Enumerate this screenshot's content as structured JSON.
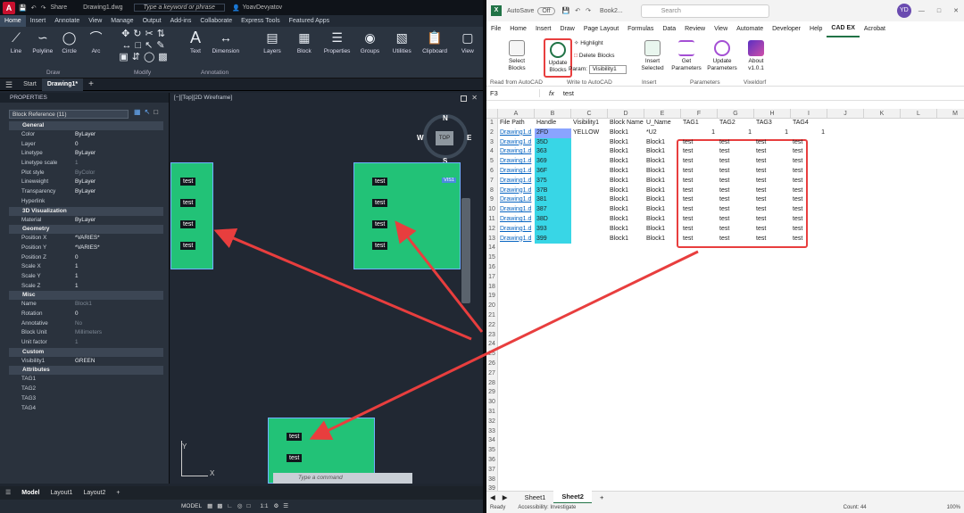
{
  "autocad": {
    "title_file": "Drawing1.dwg",
    "share_label": "Share",
    "search_placeholder": "Type a keyword or phrase",
    "user": "YoavDevyatov",
    "tabs": [
      "Home",
      "Insert",
      "Annotate",
      "View",
      "Manage",
      "Output",
      "Add-ins",
      "Collaborate",
      "Express Tools",
      "Featured Apps"
    ],
    "active_tab": "Home",
    "ribbon": {
      "draw_tools": [
        "Line",
        "Polyline",
        "Circle",
        "Arc"
      ],
      "draw_group": "Draw",
      "modify_group": "Modify",
      "annotation_tools": [
        "Text",
        "Dimension"
      ],
      "annotation_group": "Annotation",
      "big_tools": [
        "Layers",
        "Block",
        "Properties",
        "Groups",
        "Utilities",
        "Clipboard",
        "View"
      ]
    },
    "doc_tabs": [
      "Start",
      "Drawing1*"
    ],
    "properties": {
      "title": "PROPERTIES",
      "selection": "Block Reference (11)",
      "sections": [
        {
          "name": "General",
          "rows": [
            [
              "Color",
              "ByLayer"
            ],
            [
              "Layer",
              "0"
            ],
            [
              "Linetype",
              "ByLayer"
            ],
            [
              "Linetype scale",
              "1"
            ],
            [
              "Plot style",
              "ByColor"
            ],
            [
              "Lineweight",
              "ByLayer"
            ],
            [
              "Transparency",
              "ByLayer"
            ],
            [
              "Hyperlink",
              ""
            ]
          ]
        },
        {
          "name": "3D Visualization",
          "rows": [
            [
              "Material",
              "ByLayer"
            ]
          ]
        },
        {
          "name": "Geometry",
          "rows": [
            [
              "Position X",
              "*VARIES*"
            ],
            [
              "Position Y",
              "*VARIES*"
            ],
            [
              "Position Z",
              "0"
            ],
            [
              "Scale X",
              "1"
            ],
            [
              "Scale Y",
              "1"
            ],
            [
              "Scale Z",
              "1"
            ]
          ]
        },
        {
          "name": "Misc",
          "rows": [
            [
              "Name",
              "Block1"
            ],
            [
              "Rotation",
              "0"
            ],
            [
              "Annotative",
              "No"
            ],
            [
              "Block Unit",
              "Millimeters"
            ],
            [
              "Unit factor",
              "1"
            ]
          ]
        },
        {
          "name": "Custom",
          "rows": [
            [
              "Visibility1",
              "GREEN"
            ]
          ]
        },
        {
          "name": "Attributes",
          "rows": [
            [
              "TAG1",
              ""
            ],
            [
              "TAG2",
              ""
            ],
            [
              "TAG3",
              ""
            ],
            [
              "TAG4",
              ""
            ]
          ]
        }
      ]
    },
    "viewport_label": "[−][Top][2D Wireframe]",
    "viewcube_label": "TOP",
    "compass": {
      "n": "N",
      "w": "W",
      "e": "E",
      "s": "S"
    },
    "tag_text": "test",
    "block_label": "VIS1",
    "command_placeholder": "Type a command",
    "layout_tabs": [
      "Model",
      "Layout1",
      "Layout2"
    ],
    "status": {
      "model": "MODEL",
      "scale": "1:1"
    }
  },
  "excel": {
    "autosave": "AutoSave",
    "autosave_state": "Off",
    "book": "Book2...",
    "search_placeholder": "Search",
    "user_initials": "YD",
    "menu": [
      "File",
      "Home",
      "Insert",
      "Draw",
      "Page Layout",
      "Formulas",
      "Data",
      "Review",
      "View",
      "Automate",
      "Developer",
      "Help",
      "CAD EX",
      "Acrobat"
    ],
    "active_menu": "CAD EX",
    "ribbon": {
      "select_blocks": "Select Blocks",
      "update_blocks": "Update Blocks",
      "highlight": "Highlight",
      "delete_blocks": "Delete Blocks",
      "param_label": "Param:",
      "param_value": "Visibility1",
      "insert_selected": "Insert Selected",
      "get_parameters": "Get Parameters",
      "update_parameters": "Update Parameters",
      "about": "About v1.0.1",
      "groups": [
        "Read from AutoCAD",
        "Write to AutoCAD",
        "Insert",
        "Parameters",
        "Vixeldorf"
      ]
    },
    "name_box": "F3",
    "formula": "test",
    "columns": [
      "A",
      "B",
      "C",
      "D",
      "E",
      "F",
      "G",
      "H",
      "I",
      "J",
      "K",
      "L",
      "M"
    ],
    "rows": [
      [
        "File Path",
        "Handle",
        "Visibility1",
        "Block Name",
        "U_Name",
        "TAG1",
        "TAG2",
        "TAG3",
        "TAG4"
      ],
      [
        "Drawing1.d",
        "2FD",
        "YELLOW",
        "Block1",
        "*U2",
        "1",
        "1",
        "1",
        "1"
      ],
      [
        "Drawing1.d",
        "35D",
        "",
        "Block1",
        "Block1",
        "test",
        "test",
        "test",
        "test"
      ],
      [
        "Drawing1.d",
        "363",
        "",
        "Block1",
        "Block1",
        "test",
        "test",
        "test",
        "test"
      ],
      [
        "Drawing1.d",
        "369",
        "",
        "Block1",
        "Block1",
        "test",
        "test",
        "test",
        "test"
      ],
      [
        "Drawing1.d",
        "36F",
        "",
        "Block1",
        "Block1",
        "test",
        "test",
        "test",
        "test"
      ],
      [
        "Drawing1.d",
        "375",
        "",
        "Block1",
        "Block1",
        "test",
        "test",
        "test",
        "test"
      ],
      [
        "Drawing1.d",
        "37B",
        "",
        "Block1",
        "Block1",
        "test",
        "test",
        "test",
        "test"
      ],
      [
        "Drawing1.d",
        "381",
        "",
        "Block1",
        "Block1",
        "test",
        "test",
        "test",
        "test"
      ],
      [
        "Drawing1.d",
        "387",
        "",
        "Block1",
        "Block1",
        "test",
        "test",
        "test",
        "test"
      ],
      [
        "Drawing1.d",
        "38D",
        "",
        "Block1",
        "Block1",
        "test",
        "test",
        "test",
        "test"
      ],
      [
        "Drawing1.d",
        "393",
        "",
        "Block1",
        "Block1",
        "test",
        "test",
        "test",
        "test"
      ],
      [
        "Drawing1.d",
        "399",
        "",
        "Block1",
        "Block1",
        "test",
        "test",
        "test",
        "test"
      ]
    ],
    "sheets": [
      "Sheet1",
      "Sheet2"
    ],
    "active_sheet": "Sheet2",
    "status": {
      "ready": "Ready",
      "accessibility": "Accessibility: Investigate",
      "count": "Count: 44",
      "zoom": "100%"
    }
  },
  "colors": {
    "cad_bg": "#1f2630",
    "block_green": "#22c277",
    "excel_green": "#217346",
    "highlight_cyan": "#38d6e6",
    "annotation_red": "#e83e3e"
  }
}
